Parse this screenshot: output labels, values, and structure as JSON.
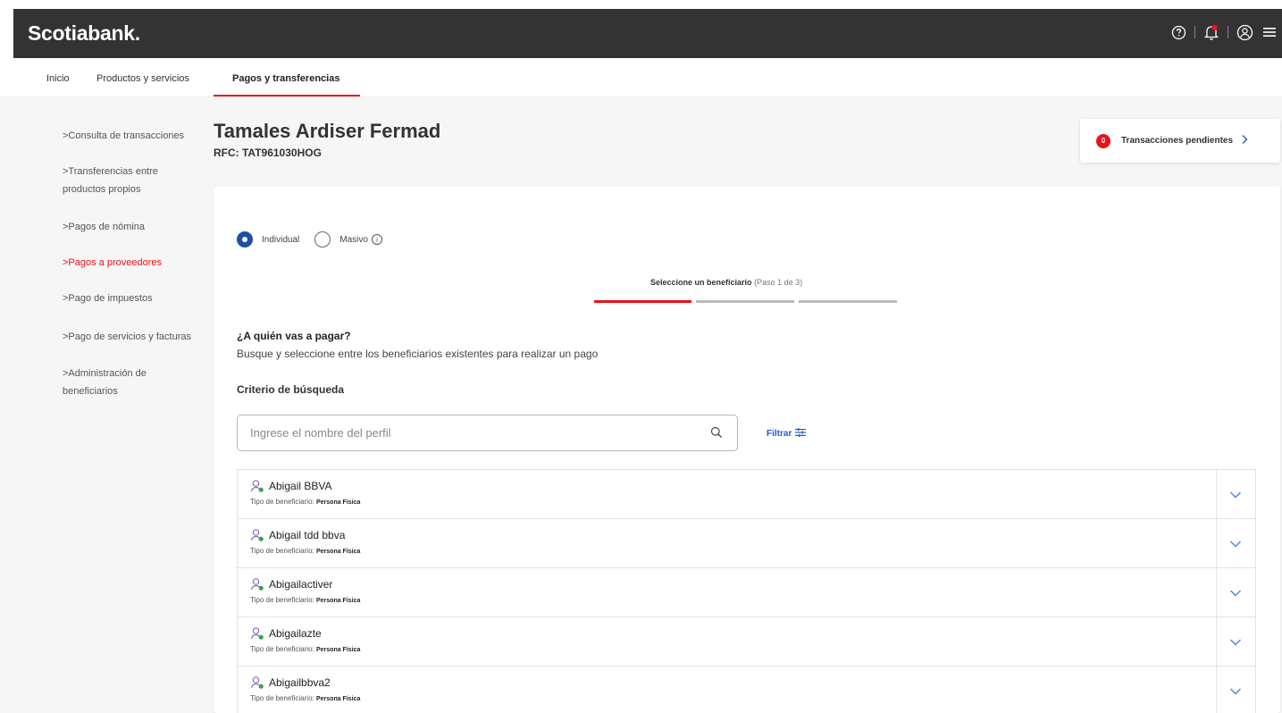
{
  "header": {
    "logo": "Scotiabank."
  },
  "nav": {
    "tabs": [
      "Inicio",
      "Productos y servicios",
      "Pagos y transferencias"
    ],
    "active_index": 2
  },
  "sidebar": {
    "items": [
      {
        "label": ">Consulta de transacciones"
      },
      {
        "label": ">Transferencias entre productos propios"
      },
      {
        "label": ">Pagos de nómina"
      },
      {
        "label": ">Pagos a proveedores",
        "active": true
      },
      {
        "label": ">Pago de impuestos"
      },
      {
        "label": ">Pago de servicios y facturas"
      },
      {
        "label": ">Administración de beneficiarios"
      }
    ]
  },
  "profile": {
    "name": "Tamales Ardiser Fermad",
    "rfc": "RFC: TAT961030HOG"
  },
  "pending": {
    "count": "0",
    "label": "Transacciones pendientes"
  },
  "payment_mode": {
    "options": [
      {
        "label": "Individual",
        "selected": true
      },
      {
        "label": "Masivo",
        "selected": false
      }
    ]
  },
  "stepper": {
    "title": "Seleccione un beneficiario",
    "step_text": "(Paso 1 de 3)",
    "current": 1,
    "total": 3
  },
  "content": {
    "question": "¿A quién vas a pagar?",
    "description": "Busque y seleccione entre los beneficiarios existentes para realizar un pago",
    "criteria_label": "Criterio de búsqueda"
  },
  "search": {
    "placeholder": "Ingrese el nombre del perfil",
    "value": "",
    "filter_label": "Filtrar"
  },
  "beneficiaries": {
    "type_label": "Tipo de beneficiario:",
    "items": [
      {
        "name": "Abigail BBVA",
        "type": "Persona Física"
      },
      {
        "name": "Abigail tdd bbva",
        "type": "Persona Física"
      },
      {
        "name": "Abigailactiver",
        "type": "Persona Física"
      },
      {
        "name": "Abigailazte",
        "type": "Persona Física"
      },
      {
        "name": "Abigailbbva2",
        "type": "Persona Física"
      }
    ]
  },
  "colors": {
    "accent_red": "#ec111a",
    "header_bg": "#333333",
    "primary_blue": "#1d4fa5",
    "link_blue": "#1d5ec2"
  },
  "icons": [
    "help-icon",
    "notification-icon",
    "user-icon",
    "menu-icon",
    "search-icon",
    "filter-icon",
    "info-icon",
    "user-beneficiary-icon",
    "chevron-down-icon",
    "chevron-right-icon"
  ]
}
